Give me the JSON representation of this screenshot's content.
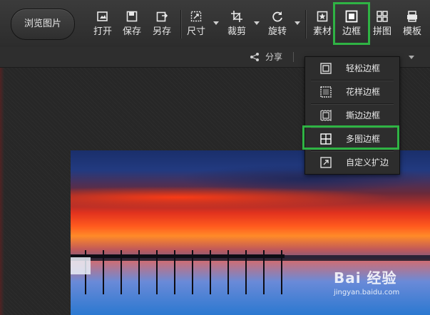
{
  "toolbar": {
    "browse_label": "浏览图片",
    "tools": [
      {
        "label": "打开",
        "icon": "open-icon"
      },
      {
        "label": "保存",
        "icon": "save-icon"
      },
      {
        "label": "另存",
        "icon": "save-as-icon"
      },
      {
        "label": "尺寸",
        "icon": "resize-icon"
      },
      {
        "label": "裁剪",
        "icon": "crop-icon"
      },
      {
        "label": "旋转",
        "icon": "rotate-icon"
      },
      {
        "label": "素材",
        "icon": "material-icon"
      },
      {
        "label": "边框",
        "icon": "border-icon"
      },
      {
        "label": "拼图",
        "icon": "collage-icon"
      },
      {
        "label": "模板",
        "icon": "template-icon"
      }
    ]
  },
  "subbar": {
    "share_label": "分享"
  },
  "border_menu": {
    "items": [
      {
        "label": "轻松边框",
        "icon": "simple-border-icon"
      },
      {
        "label": "花样边框",
        "icon": "pattern-border-icon"
      },
      {
        "label": "撕边边框",
        "icon": "torn-edge-border-icon"
      },
      {
        "label": "多图边框",
        "icon": "multi-image-border-icon"
      },
      {
        "label": "自定义扩边",
        "icon": "custom-expand-icon"
      }
    ]
  },
  "watermark": {
    "brand": "Bai 经验",
    "site": "jingyan.baidu.com"
  },
  "colors": {
    "highlight": "#2fb344",
    "toolbar_bg": "#333333",
    "menu_bg": "#2d2d2d"
  }
}
